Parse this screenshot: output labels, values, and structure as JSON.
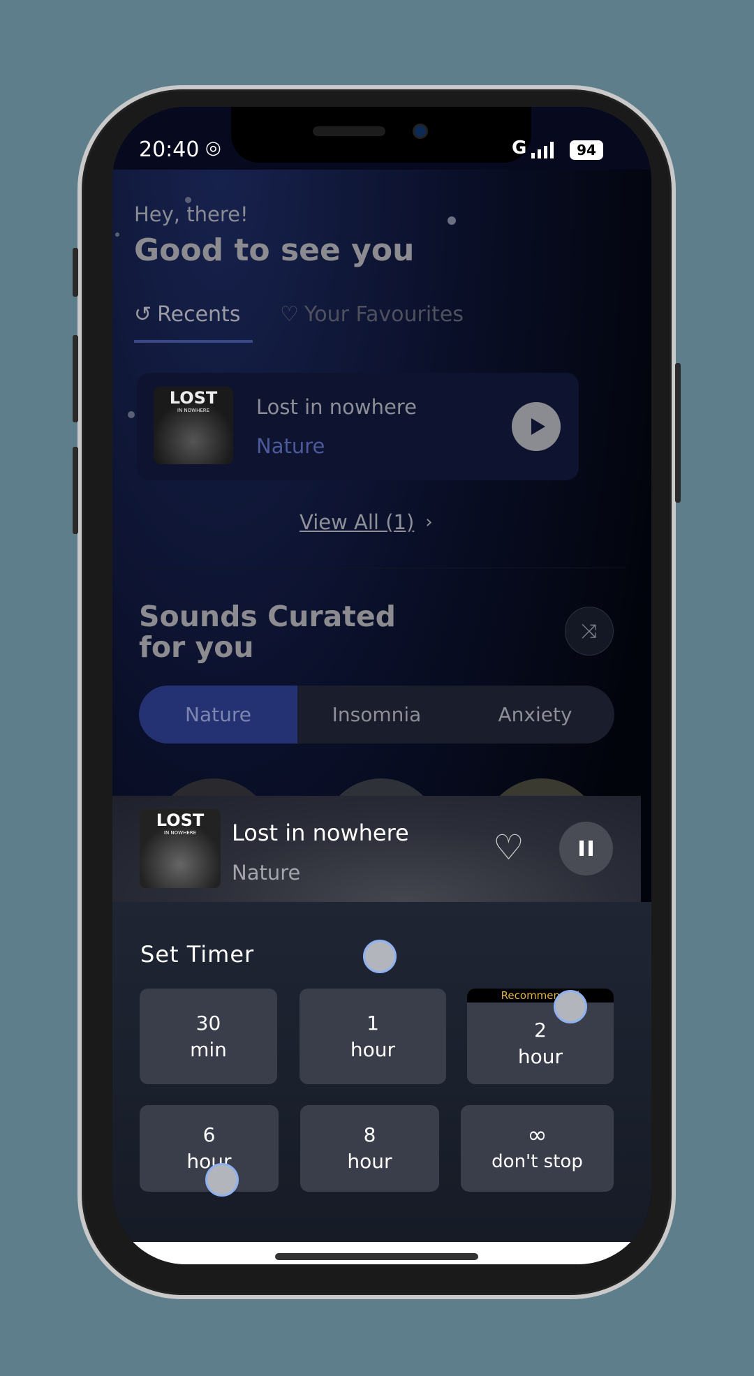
{
  "status": {
    "time": "20:40",
    "network": "G",
    "battery": "94"
  },
  "greeting": {
    "small": "Hey, there!",
    "large": "Good to see you"
  },
  "tabs": [
    {
      "label": "Recents",
      "icon": "history-icon",
      "active": true
    },
    {
      "label": "Your Favourites",
      "icon": "heart-outline-icon",
      "active": false
    }
  ],
  "recent": {
    "title": "Lost in nowhere",
    "category": "Nature",
    "art_text": "LOST",
    "art_sub": "IN NOWHERE"
  },
  "view_all": "View All (1)",
  "curated": {
    "title_line1": "Sounds Curated",
    "title_line2": "for you",
    "shuffle_icon": "shuffle-icon"
  },
  "segments": [
    {
      "label": "Nature",
      "active": true
    },
    {
      "label": "Insomnia",
      "active": false
    },
    {
      "label": "Anxiety",
      "active": false
    }
  ],
  "mini_player": {
    "title": "Lost in nowhere",
    "category": "Nature",
    "art_text": "LOST",
    "art_sub": "IN NOWHERE",
    "state": "playing"
  },
  "timer": {
    "title": "Set Timer",
    "options": [
      {
        "value": "30",
        "unit": "min"
      },
      {
        "value": "1",
        "unit": "hour"
      },
      {
        "value": "2",
        "unit": "hour",
        "badge": "Recommended"
      },
      {
        "value": "6",
        "unit": "hour"
      },
      {
        "value": "8",
        "unit": "hour"
      },
      {
        "value": "∞",
        "unit": "don't stop"
      }
    ]
  },
  "colors": {
    "accent": "#243173",
    "badge_text": "#e0b24a",
    "background": "#5e7e8b"
  }
}
